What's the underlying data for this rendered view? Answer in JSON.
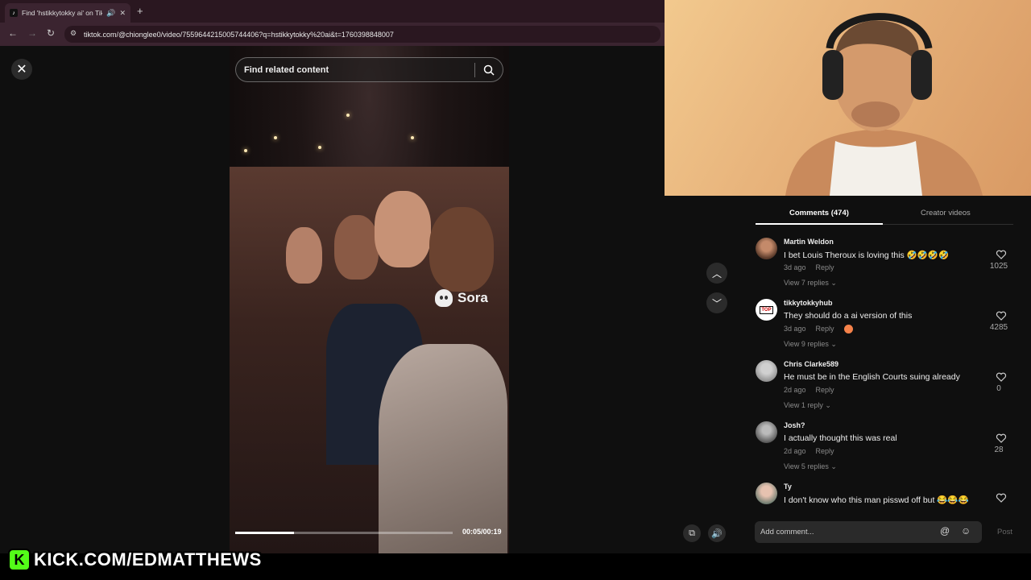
{
  "browser": {
    "tab_title": "Find 'hstikkytokky ai' on Tik",
    "url": "tiktok.com/@chionglee0/video/7559644215005744406?q=hstikkytokky%20ai&t=1760398848007"
  },
  "video": {
    "search_placeholder": "Find related content",
    "watermark": "Sora",
    "time": "00:05/00:19",
    "progress_fraction": 0.27
  },
  "panel": {
    "tabs": [
      {
        "label": "Comments (474)",
        "active": true
      },
      {
        "label": "Creator videos",
        "active": false
      }
    ],
    "comments": [
      {
        "user": "Martin Weldon",
        "text": "I bet Louis Theroux is loving this 🤣🤣🤣🤣",
        "time": "3d ago",
        "reply": "Reply",
        "replies": "View 7 replies ⌄",
        "likes": "1025"
      },
      {
        "user": "tikkytokkyhub",
        "text": "They should do a ai version of this",
        "time": "3d ago",
        "reply": "Reply",
        "replies": "View 9 replies ⌄",
        "likes": "4285"
      },
      {
        "user": "Chris Clarke589",
        "text": "He must be in the English Courts suing already",
        "time": "2d ago",
        "reply": "Reply",
        "replies": "View 1 reply ⌄",
        "likes": "0"
      },
      {
        "user": "Josh?",
        "text": "I actually thought this was real",
        "time": "2d ago",
        "reply": "Reply",
        "replies": "View 5 replies ⌄",
        "likes": "28"
      },
      {
        "user": "Ty",
        "text": "I don't know who this man pisswd off but 😂😂😂",
        "time": "",
        "reply": "",
        "replies": "",
        "likes": ""
      }
    ],
    "add_comment_placeholder": "Add comment...",
    "post_label": "Post"
  },
  "banner": {
    "k": "K",
    "text": "KICK.COM/EDMATTHEWS"
  },
  "colors": {
    "kick_green": "#53fc18",
    "browser_bg": "#2a1720"
  }
}
